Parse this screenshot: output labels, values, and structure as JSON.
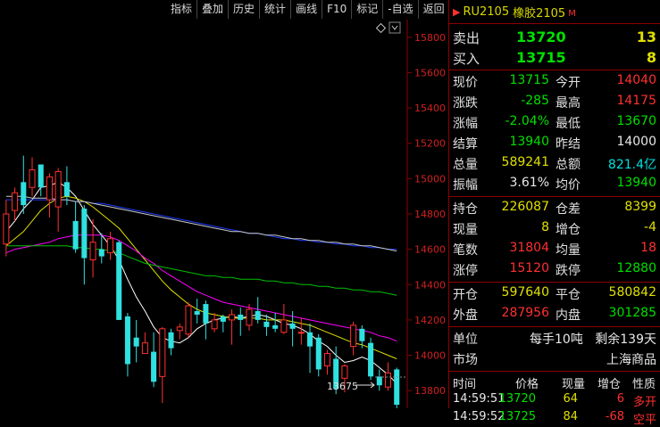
{
  "toolbar": [
    "指标",
    "叠加",
    "历史",
    "统计",
    "画线",
    "F10",
    "标记",
    "-自选",
    "返回"
  ],
  "chart": {
    "diamond_icon": "diamond-icon",
    "dropdown_icon": "chevron-down-icon",
    "last_price_label": "13675",
    "price_ticks": [
      "15800",
      "15600",
      "15400",
      "15200",
      "15000",
      "14800",
      "14600",
      "14400",
      "14200",
      "14000",
      "13800"
    ]
  },
  "chart_data": {
    "type": "candlestick",
    "ylim": [
      13700,
      15900
    ],
    "y_ticks": [
      13800,
      14000,
      14200,
      14400,
      14600,
      14800,
      15000,
      15200,
      15400,
      15600,
      15800
    ],
    "candles": [
      {
        "o": 14630,
        "c": 14800,
        "h": 14880,
        "l": 14560
      },
      {
        "o": 14820,
        "c": 14920,
        "h": 14950,
        "l": 14760
      },
      {
        "o": 14980,
        "c": 14850,
        "h": 15130,
        "l": 14800
      },
      {
        "o": 14950,
        "c": 15050,
        "h": 15120,
        "l": 14900
      },
      {
        "o": 15080,
        "c": 14950,
        "h": 15080,
        "l": 14900
      },
      {
        "o": 14880,
        "c": 15010,
        "h": 15030,
        "l": 14780
      },
      {
        "o": 14840,
        "c": 15040,
        "h": 15060,
        "l": 14700
      },
      {
        "o": 14980,
        "c": 14900,
        "h": 15070,
        "l": 14850
      },
      {
        "o": 14760,
        "c": 14600,
        "h": 14870,
        "l": 14580
      },
      {
        "o": 14830,
        "c": 14550,
        "h": 14850,
        "l": 14400
      },
      {
        "o": 14540,
        "c": 14640,
        "h": 14770,
        "l": 14440
      },
      {
        "o": 14600,
        "c": 14560,
        "h": 14690,
        "l": 14520
      },
      {
        "o": 14580,
        "c": 14660,
        "h": 14700,
        "l": 14540
      },
      {
        "o": 14640,
        "c": 14200,
        "h": 14650,
        "l": 14200
      },
      {
        "o": 14220,
        "c": 13950,
        "h": 14240,
        "l": 13880
      },
      {
        "o": 14100,
        "c": 14050,
        "h": 14200,
        "l": 13960
      },
      {
        "o": 14010,
        "c": 14070,
        "h": 14130,
        "l": 14010
      },
      {
        "o": 14020,
        "c": 13850,
        "h": 14130,
        "l": 13820
      },
      {
        "o": 13880,
        "c": 14150,
        "h": 14160,
        "l": 13730
      },
      {
        "o": 14130,
        "c": 14040,
        "h": 14150,
        "l": 14000
      },
      {
        "o": 14140,
        "c": 14160,
        "h": 14180,
        "l": 14090
      },
      {
        "o": 14120,
        "c": 14280,
        "h": 14300,
        "l": 14100
      },
      {
        "o": 14250,
        "c": 14230,
        "h": 14320,
        "l": 14180
      },
      {
        "o": 14290,
        "c": 14180,
        "h": 14310,
        "l": 14090
      },
      {
        "o": 14150,
        "c": 14200,
        "h": 14240,
        "l": 14130
      },
      {
        "o": 14220,
        "c": 14190,
        "h": 14230,
        "l": 14130
      },
      {
        "o": 14200,
        "c": 14230,
        "h": 14260,
        "l": 14060
      },
      {
        "o": 14230,
        "c": 14200,
        "h": 14270,
        "l": 14110
      },
      {
        "o": 14170,
        "c": 14260,
        "h": 14290,
        "l": 14140
      },
      {
        "o": 14250,
        "c": 14200,
        "h": 14330,
        "l": 14180
      },
      {
        "o": 14190,
        "c": 14160,
        "h": 14230,
        "l": 14110
      },
      {
        "o": 14170,
        "c": 14150,
        "h": 14240,
        "l": 14130
      },
      {
        "o": 14130,
        "c": 14200,
        "h": 14290,
        "l": 14120
      },
      {
        "o": 14180,
        "c": 14150,
        "h": 14250,
        "l": 14050
      },
      {
        "o": 14130,
        "c": 14130,
        "h": 14210,
        "l": 14060
      },
      {
        "o": 14130,
        "c": 14050,
        "h": 14180,
        "l": 13900
      },
      {
        "o": 14100,
        "c": 13920,
        "h": 14120,
        "l": 13880
      },
      {
        "o": 13940,
        "c": 14010,
        "h": 14030,
        "l": 13890
      },
      {
        "o": 13980,
        "c": 13810,
        "h": 14050,
        "l": 13780
      },
      {
        "o": 13870,
        "c": 13940,
        "h": 13950,
        "l": 13790
      },
      {
        "o": 14050,
        "c": 14170,
        "h": 14190,
        "l": 14000
      },
      {
        "o": 14150,
        "c": 14080,
        "h": 14170,
        "l": 14040
      },
      {
        "o": 14070,
        "c": 13880,
        "h": 14100,
        "l": 13860
      },
      {
        "o": 13880,
        "c": 13830,
        "h": 13920,
        "l": 13800
      },
      {
        "o": 13820,
        "c": 13900,
        "h": 13960,
        "l": 13800
      },
      {
        "o": 13920,
        "c": 13720,
        "h": 13930,
        "l": 13675
      }
    ],
    "ma_series": [
      {
        "color": "#ffffff",
        "values": [
          14700,
          14760,
          14830,
          14880,
          14950,
          14960,
          14980,
          14950,
          14900,
          14820,
          14740,
          14680,
          14620,
          14540,
          14430,
          14330,
          14250,
          14160,
          14100,
          14080,
          14070,
          14100,
          14150,
          14180,
          14200,
          14210,
          14220,
          14210,
          14220,
          14230,
          14220,
          14200,
          14180,
          14170,
          14150,
          14120,
          14080,
          14050,
          14000,
          13960,
          13970,
          13990,
          13970,
          13930,
          13890,
          13840
        ]
      },
      {
        "color": "#e0e000",
        "values": [
          14620,
          14660,
          14700,
          14760,
          14820,
          14860,
          14890,
          14900,
          14890,
          14870,
          14840,
          14800,
          14760,
          14720,
          14660,
          14600,
          14540,
          14480,
          14420,
          14370,
          14330,
          14290,
          14260,
          14240,
          14230,
          14220,
          14210,
          14210,
          14210,
          14210,
          14200,
          14200,
          14200,
          14190,
          14180,
          14170,
          14150,
          14130,
          14110,
          14090,
          14070,
          14060,
          14040,
          14020,
          14000,
          13980
        ]
      },
      {
        "color": "#ff00ff",
        "values": [
          14580,
          14600,
          14610,
          14620,
          14630,
          14640,
          14660,
          14670,
          14680,
          14680,
          14680,
          14680,
          14670,
          14650,
          14620,
          14590,
          14550,
          14520,
          14480,
          14450,
          14420,
          14390,
          14360,
          14340,
          14320,
          14300,
          14290,
          14280,
          14270,
          14260,
          14250,
          14240,
          14230,
          14220,
          14210,
          14200,
          14190,
          14180,
          14170,
          14160,
          14150,
          14140,
          14130,
          14110,
          14100,
          14080
        ]
      },
      {
        "color": "#00c000",
        "values": [
          14620,
          14620,
          14620,
          14620,
          14620,
          14620,
          14620,
          14620,
          14610,
          14610,
          14600,
          14600,
          14590,
          14580,
          14560,
          14540,
          14520,
          14510,
          14500,
          14490,
          14480,
          14470,
          14460,
          14450,
          14450,
          14440,
          14440,
          14430,
          14430,
          14430,
          14420,
          14420,
          14410,
          14410,
          14400,
          14400,
          14390,
          14390,
          14380,
          14380,
          14370,
          14370,
          14360,
          14360,
          14350,
          14340
        ]
      },
      {
        "color": "#1c3cff",
        "values": [
          14880,
          14880,
          14880,
          14880,
          14880,
          14880,
          14880,
          14880,
          14870,
          14870,
          14860,
          14860,
          14850,
          14840,
          14830,
          14820,
          14810,
          14800,
          14790,
          14780,
          14770,
          14760,
          14750,
          14740,
          14730,
          14720,
          14710,
          14700,
          14690,
          14690,
          14680,
          14670,
          14660,
          14660,
          14650,
          14650,
          14640,
          14640,
          14630,
          14630,
          14620,
          14620,
          14610,
          14610,
          14600,
          14600
        ]
      },
      {
        "color": "#c8c8c8",
        "values": [
          14900,
          14900,
          14900,
          14890,
          14890,
          14890,
          14880,
          14880,
          14870,
          14870,
          14860,
          14850,
          14840,
          14830,
          14820,
          14810,
          14800,
          14790,
          14780,
          14770,
          14760,
          14750,
          14740,
          14730,
          14720,
          14710,
          14700,
          14700,
          14690,
          14690,
          14680,
          14680,
          14670,
          14660,
          14660,
          14650,
          14650,
          14640,
          14640,
          14630,
          14630,
          14620,
          14620,
          14610,
          14600,
          14590
        ]
      }
    ]
  },
  "header": {
    "code": "RU2105",
    "name": "橡胶2105",
    "mark": "M"
  },
  "quote": {
    "sell_label": "卖出",
    "sell_price": "13720",
    "sell_vol": "13",
    "buy_label": "买入",
    "buy_price": "13715",
    "buy_vol": "8"
  },
  "stats": [
    {
      "l1": "现价",
      "v1": "13715",
      "c1": "g",
      "l2": "今开",
      "v2": "14040",
      "c2": "r"
    },
    {
      "l1": "涨跌",
      "v1": "-285",
      "c1": "g",
      "l2": "最高",
      "v2": "14175",
      "c2": "r"
    },
    {
      "l1": "涨幅",
      "v1": "-2.04%",
      "c1": "g",
      "l2": "最低",
      "v2": "13670",
      "c2": "g"
    },
    {
      "l1": "结算",
      "v1": "13940",
      "c1": "g",
      "l2": "昨结",
      "v2": "14000",
      "c2": "w"
    },
    {
      "l1": "总量",
      "v1": "589241",
      "c1": "y",
      "l2": "总额",
      "v2": "821.4亿",
      "c2": "c"
    },
    {
      "l1": "振幅",
      "v1": "3.61%",
      "c1": "w",
      "l2": "均价",
      "v2": "13940",
      "c2": "g"
    }
  ],
  "stats2": [
    {
      "l1": "持仓",
      "v1": "226087",
      "c1": "y",
      "l2": "仓差",
      "v2": "8399",
      "c2": "y"
    },
    {
      "l1": "现量",
      "v1": "8",
      "c1": "y",
      "l2": "增仓",
      "v2": "-4",
      "c2": "y"
    },
    {
      "l1": "笔数",
      "v1": "31804",
      "c1": "r",
      "l2": "均量",
      "v2": "18",
      "c2": "r"
    },
    {
      "l1": "涨停",
      "v1": "15120",
      "c1": "r",
      "l2": "跌停",
      "v2": "12880",
      "c2": "g"
    }
  ],
  "stats3": [
    {
      "l1": "开仓",
      "v1": "597640",
      "c1": "y",
      "l2": "平仓",
      "v2": "580842",
      "c2": "y"
    },
    {
      "l1": "外盘",
      "v1": "287956",
      "c1": "r",
      "l2": "内盘",
      "v2": "301285",
      "c2": "g"
    }
  ],
  "info": {
    "unit_label": "单位",
    "unit_value": "每手10吨",
    "days_left": "剩余139天",
    "market_label": "市场",
    "market_value": "上海商品"
  },
  "ticks": {
    "headers": [
      "时间",
      "价格",
      "现量",
      "增仓",
      "性质"
    ],
    "rows": [
      {
        "time": "14:59:51",
        "price": "13720",
        "vol": "64",
        "oi": "6",
        "nature": "多开",
        "nc": "r"
      },
      {
        "time": "14:59:52",
        "price": "13725",
        "vol": "84",
        "oi": "-68",
        "nature": "空平",
        "nc": "r"
      }
    ]
  }
}
